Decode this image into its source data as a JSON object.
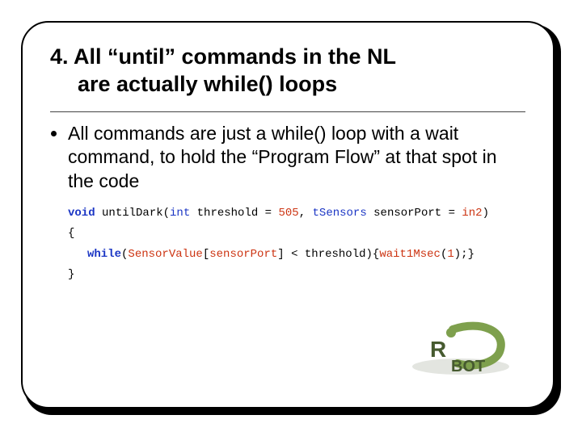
{
  "title": {
    "line1": "4. All “until” commands in the NL",
    "line2": "are actually while() loops"
  },
  "bullet": "All commands are just a while() loop with a wait command, to hold the “Program Flow” at that spot in the code",
  "code": {
    "kw_void": "void",
    "fn_name": " untilDark",
    "paren_open": "(",
    "type_int": "int",
    "p_thresh": " threshold ",
    "eq1": "= ",
    "val_505": "505",
    "comma": ", ",
    "type_tsensors": "tSensors",
    "p_sensor": " sensorPort ",
    "eq2": "= ",
    "val_in2": "in2",
    "paren_close": ")",
    "brace_open": "{",
    "kw_while": "while",
    "wp_open": "(",
    "sv": "SensorValue",
    "br_open": "[",
    "sv_var": "sensorPort",
    "br_close": "]",
    "lt": " < ",
    "thr_ref": "threshold",
    "wp_close": ")",
    "body_open": "{",
    "wait": "wait1Msec",
    "wait_po": "(",
    "wait_arg": "1",
    "wait_pc": ")",
    "semi": ";",
    "body_close": "}",
    "brace_close": "}"
  },
  "logo": {
    "text_r": "R",
    "text_bot": "BOT"
  }
}
